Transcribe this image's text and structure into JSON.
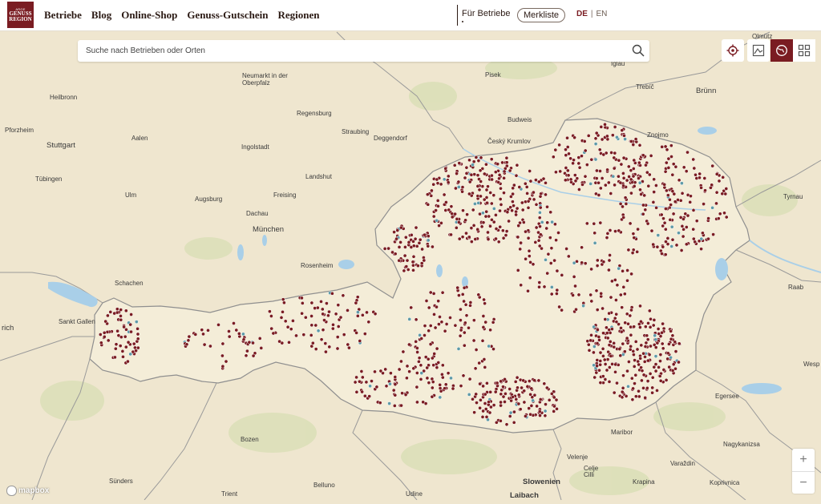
{
  "header": {
    "logo": {
      "line1": "ARGE",
      "line2": "GENUSS",
      "line3": "REGION"
    },
    "nav": [
      "Betriebe",
      "Blog",
      "Online-Shop",
      "Genuss-Gutschein",
      "Regionen"
    ],
    "fuer_betriebe": "Für Betriebe",
    "merkliste": "Merkliste",
    "lang_de": "DE",
    "lang_sep": "|",
    "lang_en": "EN"
  },
  "search": {
    "placeholder": "Suche nach Betrieben oder Orten"
  },
  "map_controls": {
    "locate": "locate-icon",
    "map_view": "map-image-icon",
    "globe_view": "globe-icon",
    "grid_view": "grid-icon",
    "active_color": "#7a1c22",
    "zoom_in": "+",
    "zoom_out": "−"
  },
  "attribution": "mapbox",
  "colors": {
    "land": "#efe6cf",
    "austria": "#f4edd8",
    "marker_primary": "#7a1c22",
    "marker_secondary": "#5e9aa8",
    "border": "#8f8f8f",
    "water": "#a9cfe8"
  },
  "places": [
    {
      "name": "Olmütz",
      "big": false
    },
    {
      "name": "Pisek",
      "big": false
    },
    {
      "name": "Iglau",
      "big": false
    },
    {
      "name": "Třebíč",
      "big": false
    },
    {
      "name": "Brünn",
      "big": true
    },
    {
      "name": "Neumarkt in der Oberpfalz",
      "big": false
    },
    {
      "name": "Heilbronn",
      "big": false
    },
    {
      "name": "Regensburg",
      "big": false
    },
    {
      "name": "Budweis",
      "big": false
    },
    {
      "name": "Pforzheim",
      "big": false
    },
    {
      "name": "Straubing",
      "big": false
    },
    {
      "name": "Deggendorf",
      "big": false
    },
    {
      "name": "Znojmo",
      "big": false
    },
    {
      "name": "Aalen",
      "big": false
    },
    {
      "name": "Český Krumlov",
      "big": false
    },
    {
      "name": "Stuttgart",
      "big": true
    },
    {
      "name": "Ingolstadt",
      "big": false
    },
    {
      "name": "Tübingen",
      "big": false
    },
    {
      "name": "Landshut",
      "big": false
    },
    {
      "name": "Ulm",
      "big": false
    },
    {
      "name": "Augsburg",
      "big": false
    },
    {
      "name": "Freising",
      "big": false
    },
    {
      "name": "Tyrnau",
      "big": false
    },
    {
      "name": "Dachau",
      "big": false
    },
    {
      "name": "München",
      "big": true
    },
    {
      "name": "Rosenheim",
      "big": false
    },
    {
      "name": "Schachen",
      "big": false
    },
    {
      "name": "Raab",
      "big": false
    },
    {
      "name": "Sankt Gallen",
      "big": false
    },
    {
      "name": "rich",
      "big": true
    },
    {
      "name": "Wesp",
      "big": false
    },
    {
      "name": "Egersee",
      "big": false
    },
    {
      "name": "Bozen",
      "big": false
    },
    {
      "name": "Maribor",
      "big": false
    },
    {
      "name": "Nagykanizsa",
      "big": false
    },
    {
      "name": "Velenje",
      "big": false
    },
    {
      "name": "Varaždin",
      "big": false
    },
    {
      "name": "Celje",
      "big": false
    },
    {
      "name": "Cilli",
      "big": false
    },
    {
      "name": "Sünders",
      "big": false
    },
    {
      "name": "Trient",
      "big": false
    },
    {
      "name": "Belluno",
      "big": false
    },
    {
      "name": "Udine",
      "big": false
    },
    {
      "name": "Laibach",
      "big": true
    },
    {
      "name": "Slowenien",
      "big": true
    },
    {
      "name": "Krapina",
      "big": false
    },
    {
      "name": "Koprivnica",
      "big": false
    }
  ]
}
